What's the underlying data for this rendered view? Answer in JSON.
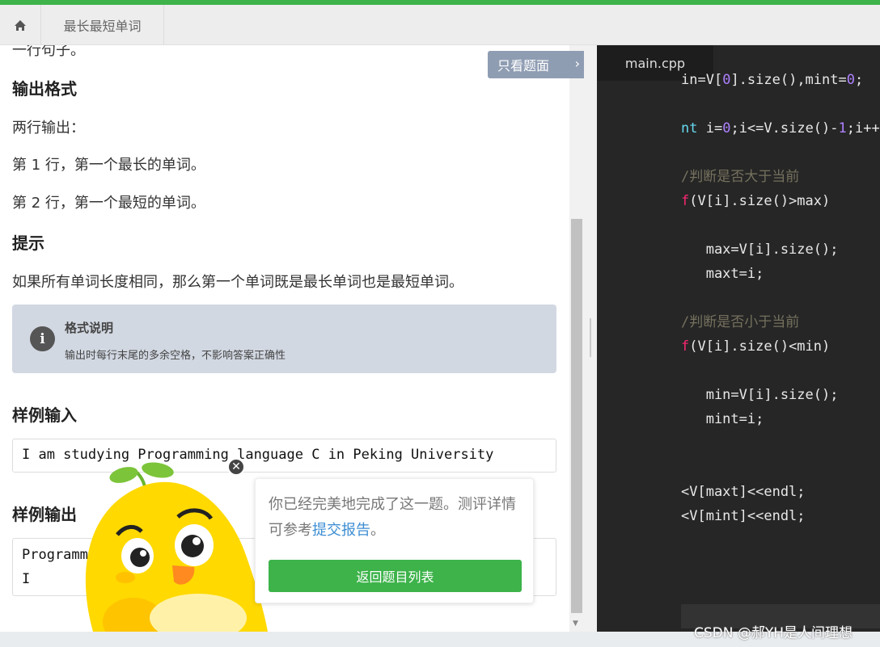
{
  "tabs": {
    "title": "最长最短单词"
  },
  "problem": {
    "cut_line": "一行句子。",
    "output_heading": "输出格式",
    "output_intro": "两行输出：",
    "output_line1": "第 1 行，第一个最长的单词。",
    "output_line2": "第 2 行，第一个最短的单词。",
    "hint_heading": "提示",
    "hint_text": "如果所有单词长度相同，那么第一个单词既是最长单词也是最短单词。",
    "notice_title": "格式说明",
    "notice_text": "输出时每行末尾的多余空格，不影响答案正确性",
    "sample_input_heading": "样例输入",
    "sample_input": "I am studying Programming language C in Peking University",
    "sample_output_heading": "样例输出",
    "sample_output_line1": "Programming",
    "sample_output_line2": "I"
  },
  "only_button": "只看题面",
  "editor": {
    "file_tab": "main.cpp"
  },
  "popup": {
    "msg_before": "你已经完美地完成了这一题。测评详情可参考",
    "link": "提交报告",
    "msg_after": "。",
    "button": "返回题目列表"
  },
  "watermark": "CSDN @郝YH是人间理想"
}
